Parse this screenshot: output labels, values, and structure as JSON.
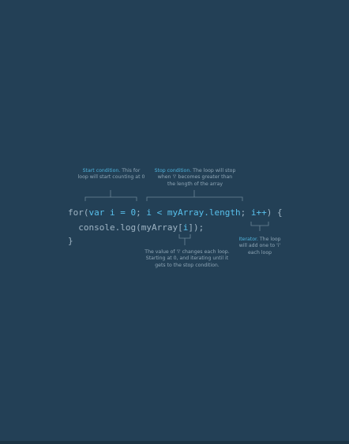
{
  "code": {
    "line1": {
      "kw_for": "for(",
      "kw_var": "var",
      "init": " i = 0",
      "sep1": "; ",
      "cond_i": "i",
      "cond_op": " < ",
      "cond_arr": "myArray.length",
      "sep2": "; ",
      "inc": "i++",
      "end": ") {"
    },
    "line2": {
      "indent": "  ",
      "call": "console.log(",
      "arr": "myArray[",
      "idx": "i",
      "close": "]);"
    },
    "line3": {
      "brace": "}"
    }
  },
  "annotations": {
    "start": {
      "title": "Start condition.",
      "line1": " This for",
      "line2": "loop will start counting at 0"
    },
    "stop": {
      "title": "Stop condition.",
      "line1": " The loop will stop",
      "line2": "when 'i' becomes greater than",
      "line3": "the length of the array"
    },
    "iterator": {
      "title": "Iterator.",
      "line1": " The loop",
      "line2": "will add one to 'i'",
      "line3": "each loop"
    },
    "value": {
      "line1": "The value of 'i' changes each loop.",
      "line2": "Starting at 0, and iterating until it",
      "line3": "gets to the stop condition."
    }
  }
}
